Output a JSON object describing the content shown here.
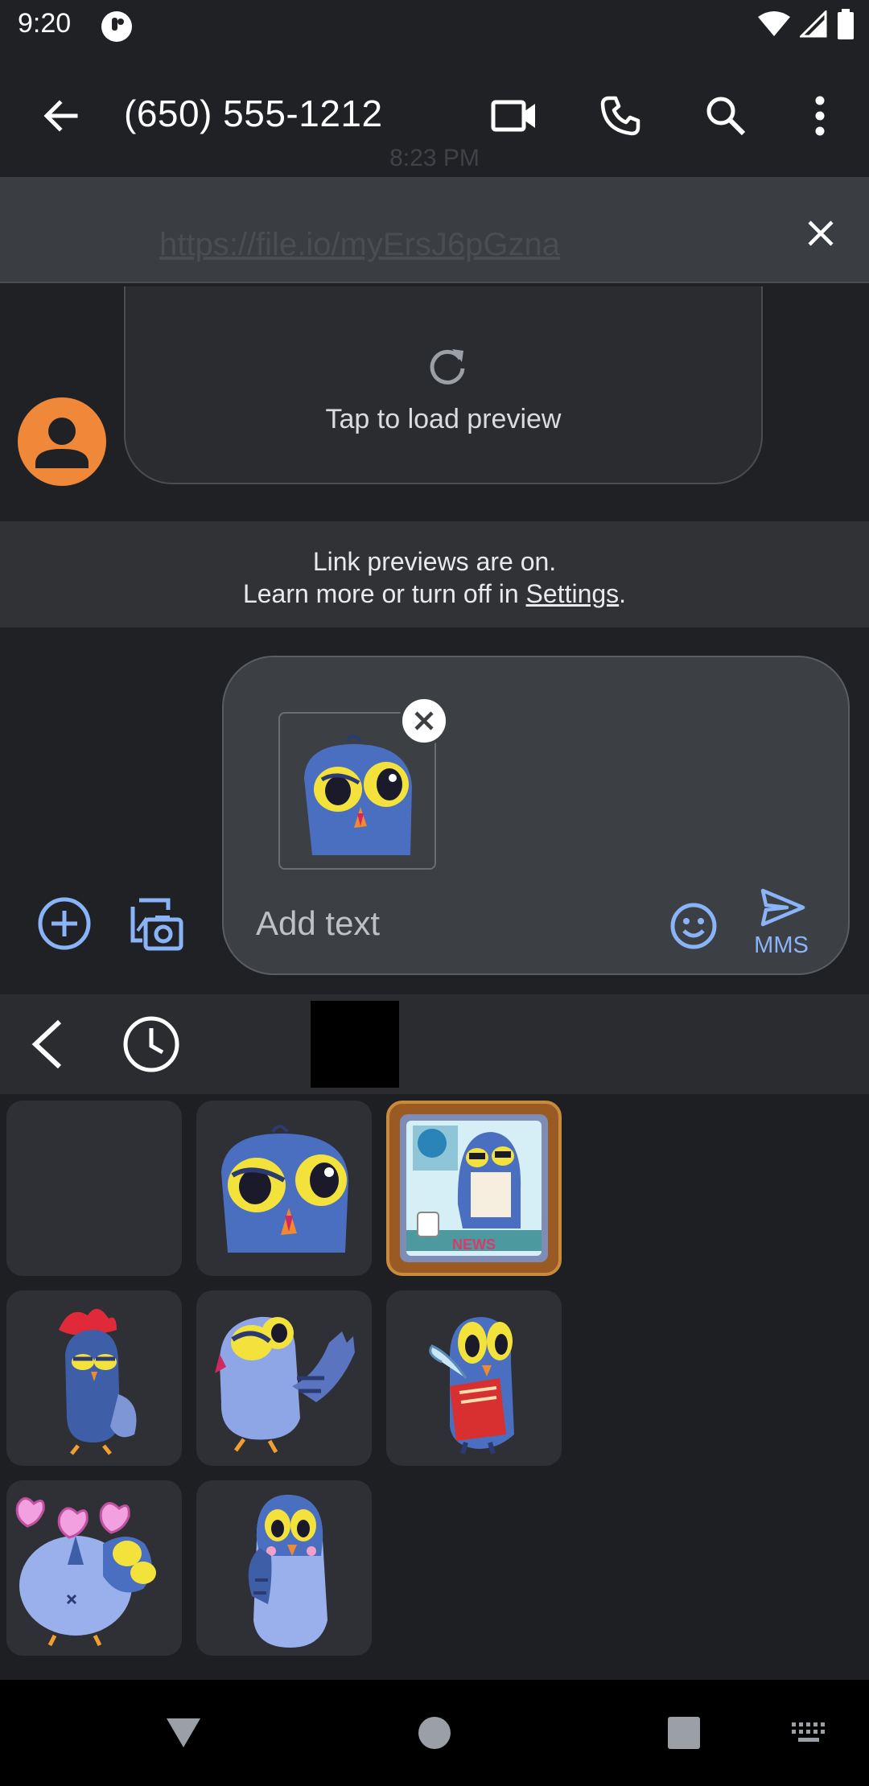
{
  "status_bar": {
    "time": "9:20"
  },
  "app_bar": {
    "title": "(650) 555-1212"
  },
  "link_banner": {
    "timestamp": "8:23 PM",
    "url": "https://file.io/myErsJ6pGzna"
  },
  "message": {
    "preview_label": "Tap to load preview"
  },
  "info": {
    "line1": "Link previews are on.",
    "line2_prefix": "Learn more or turn off in ",
    "settings_link": "Settings",
    "line2_suffix": "."
  },
  "compose": {
    "placeholder": "Add text",
    "send_label": "MMS"
  },
  "stickers": [
    {
      "name": "empty"
    },
    {
      "name": "blue bird face"
    },
    {
      "name": "bird reading news in frame"
    },
    {
      "name": "rooster bird"
    },
    {
      "name": "waving bird"
    },
    {
      "name": "bird with quill and book"
    },
    {
      "name": "bird with hearts"
    },
    {
      "name": "shy blushing bird"
    }
  ],
  "sticker_badge": {
    "news": "NEWS"
  },
  "colors": {
    "accent": "#8ab4f8",
    "avatar": "#f0883a",
    "background": "#202124"
  }
}
